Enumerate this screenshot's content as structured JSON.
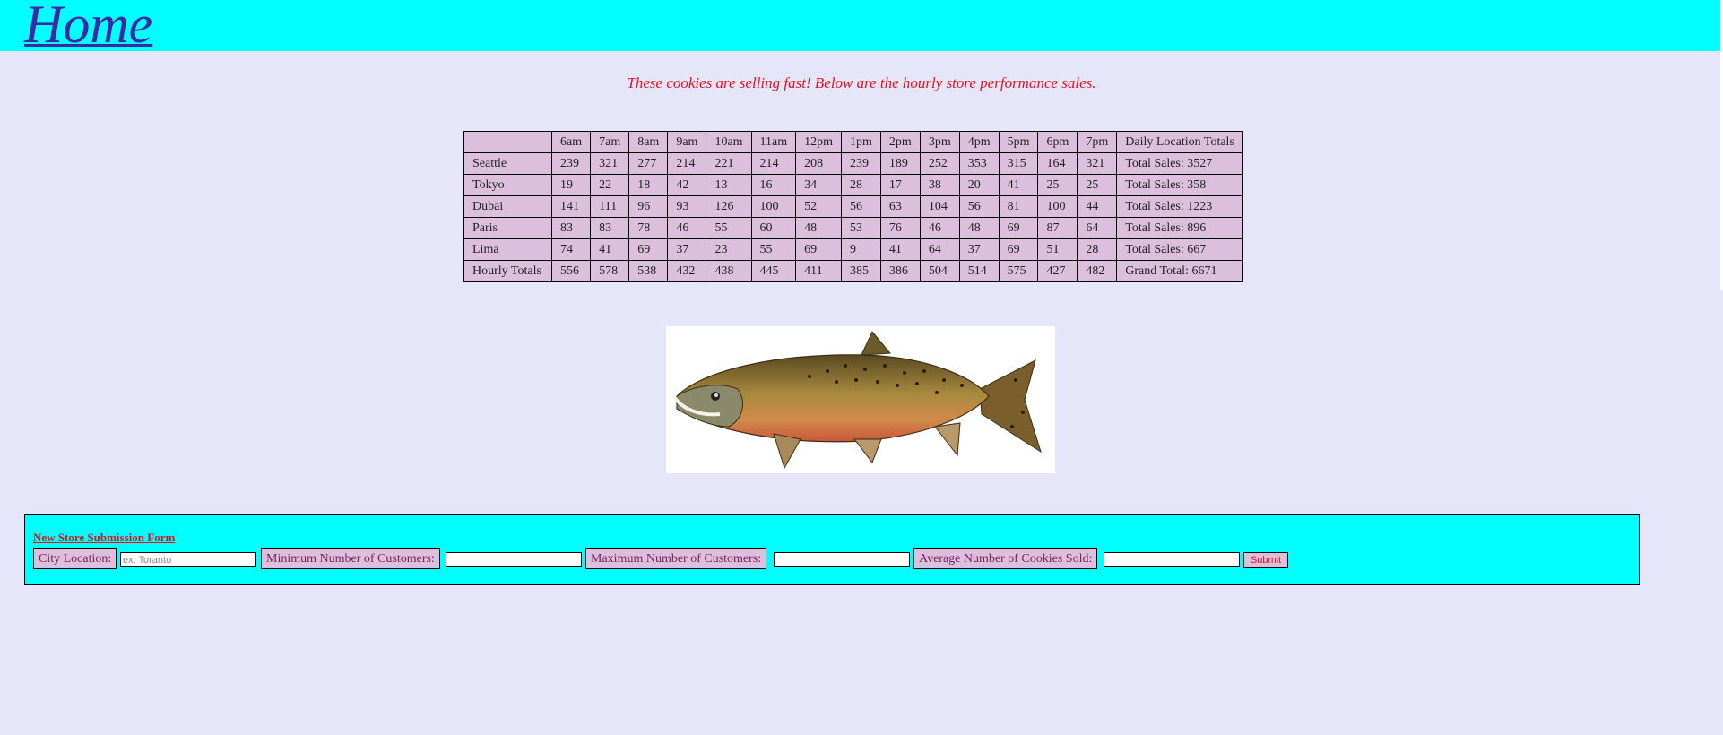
{
  "header": {
    "title": "Home"
  },
  "tagline": "These cookies are selling fast! Below are the hourly store performance sales.",
  "table": {
    "headers": [
      "",
      "6am",
      "7am",
      "8am",
      "9am",
      "10am",
      "11am",
      "12pm",
      "1pm",
      "2pm",
      "3pm",
      "4pm",
      "5pm",
      "6pm",
      "7pm",
      "Daily Location Totals"
    ],
    "rows": [
      [
        "Seattle",
        "239",
        "321",
        "277",
        "214",
        "221",
        "214",
        "208",
        "239",
        "189",
        "252",
        "353",
        "315",
        "164",
        "321",
        "Total Sales: 3527"
      ],
      [
        "Tokyo",
        "19",
        "22",
        "18",
        "42",
        "13",
        "16",
        "34",
        "28",
        "17",
        "38",
        "20",
        "41",
        "25",
        "25",
        "Total Sales: 358"
      ],
      [
        "Dubai",
        "141",
        "111",
        "96",
        "93",
        "126",
        "100",
        "52",
        "56",
        "63",
        "104",
        "56",
        "81",
        "100",
        "44",
        "Total Sales: 1223"
      ],
      [
        "Paris",
        "83",
        "83",
        "78",
        "46",
        "55",
        "60",
        "48",
        "53",
        "76",
        "46",
        "48",
        "69",
        "87",
        "64",
        "Total Sales: 896"
      ],
      [
        "Lima",
        "74",
        "41",
        "69",
        "37",
        "23",
        "55",
        "69",
        "9",
        "41",
        "64",
        "37",
        "69",
        "51",
        "28",
        "Total Sales: 667"
      ],
      [
        "Hourly Totals",
        "556",
        "578",
        "538",
        "432",
        "438",
        "445",
        "411",
        "385",
        "386",
        "504",
        "514",
        "575",
        "427",
        "482",
        "Grand Total: 6671"
      ]
    ]
  },
  "form": {
    "title": "New Store Submission Form",
    "city_label": "City Location:",
    "city_placeholder": "ex. Toranto",
    "min_label": "Minimum Number of Customers:",
    "max_label": "Maximum Number of Customers:",
    "avg_label": "Average Number of Cookies Sold:",
    "submit_label": "Submit"
  }
}
